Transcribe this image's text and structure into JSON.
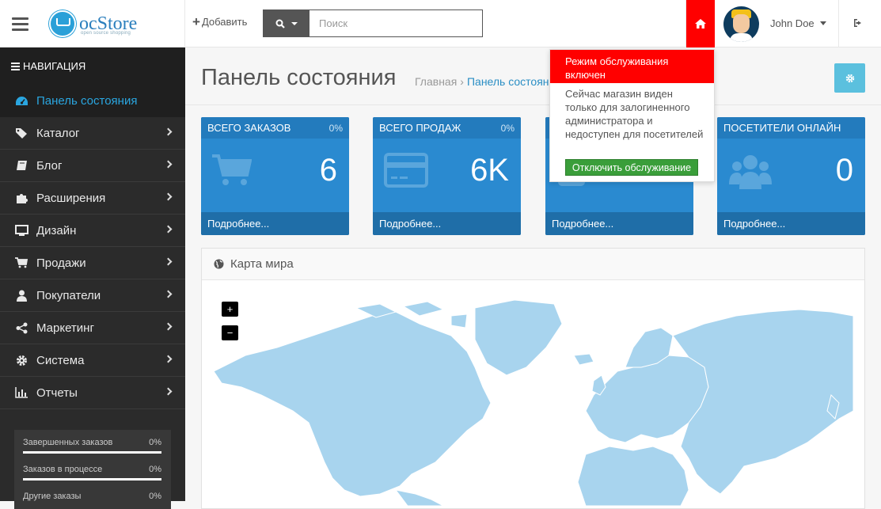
{
  "header": {
    "logo": {
      "brand": "ocStore",
      "tagline": "open source shopping"
    },
    "add_label": "Добавить",
    "search_placeholder": "Поиск",
    "user_name": "John Doe"
  },
  "sidebar": {
    "title": "НАВИГАЦИЯ",
    "items": [
      {
        "label": "Панель состояния",
        "icon": "dashboard-icon",
        "active": true
      },
      {
        "label": "Каталог",
        "icon": "tag-icon"
      },
      {
        "label": "Блог",
        "icon": "book-icon"
      },
      {
        "label": "Расширения",
        "icon": "puzzle-icon"
      },
      {
        "label": "Дизайн",
        "icon": "monitor-icon"
      },
      {
        "label": "Продажи",
        "icon": "cart-icon"
      },
      {
        "label": "Покупатели",
        "icon": "user-icon"
      },
      {
        "label": "Маркетинг",
        "icon": "share-icon"
      },
      {
        "label": "Система",
        "icon": "gear-icon"
      },
      {
        "label": "Отчеты",
        "icon": "bar-chart-icon"
      }
    ],
    "stats": [
      {
        "label": "Завершенных заказов",
        "value": "0%"
      },
      {
        "label": "Заказов в процессе",
        "value": "0%"
      },
      {
        "label": "Другие заказы",
        "value": "0%"
      }
    ]
  },
  "main": {
    "title": "Панель состояния",
    "breadcrumb": {
      "home": "Главная",
      "separator": "›",
      "current": "Панель состояния"
    },
    "tiles": [
      {
        "title": "ВСЕГО ЗАКАЗОВ",
        "pct": "0%",
        "value": "6",
        "footer": "Подробнее...",
        "icon": "cart-icon"
      },
      {
        "title": "ВСЕГО ПРОДАЖ",
        "pct": "0%",
        "value": "6K",
        "footer": "Подробнее...",
        "icon": "credit-card-icon"
      },
      {
        "title": "",
        "pct": "",
        "value": "",
        "footer": "Подробнее...",
        "icon": "user-icon"
      },
      {
        "title": "ПОСЕТИТЕЛИ ОНЛАЙН",
        "pct": "",
        "value": "0",
        "footer": "Подробнее...",
        "icon": "users-icon"
      }
    ],
    "map": {
      "title": "Карта мира",
      "zoom_in": "+",
      "zoom_out": "−"
    }
  },
  "popover": {
    "title": "Режим обслуживания включен",
    "body": "Сейчас магазин виден только для залогиненного администратора и недоступен для посетителей",
    "button": "Отключить обслуживание"
  },
  "colors": {
    "accent": "#2a8ad0",
    "sidebar": "#2b2b2b",
    "alert": "#ff0000",
    "success": "#3a9e3a",
    "map_land": "#a8d4ee"
  }
}
